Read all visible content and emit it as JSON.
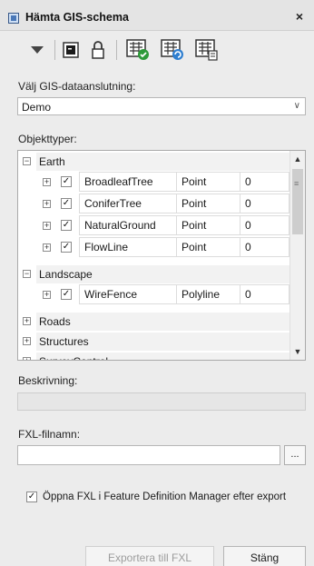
{
  "window": {
    "title": "Hämta GIS-schema",
    "close_glyph": "×"
  },
  "toolbar": {
    "buttons": [
      {
        "icon": "dropdown-arrow-icon"
      },
      {
        "icon": "terminal-window-icon"
      },
      {
        "icon": "lock-icon"
      },
      {
        "icon": "schema-check-icon"
      },
      {
        "icon": "schema-refresh-icon"
      },
      {
        "icon": "schema-export-icon"
      }
    ]
  },
  "connection": {
    "label": "Välj GIS-dataanslutning:",
    "selected": "Demo",
    "arrow_glyph": "∨"
  },
  "object_types": {
    "label": "Objekttyper:",
    "groups": [
      {
        "name": "Earth",
        "expanded": true,
        "items": [
          {
            "name": "BroadleafTree",
            "geometry": "Point",
            "count": "0",
            "checked": true
          },
          {
            "name": "ConiferTree",
            "geometry": "Point",
            "count": "0",
            "checked": true
          },
          {
            "name": "NaturalGround",
            "geometry": "Point",
            "count": "0",
            "checked": true
          },
          {
            "name": "FlowLine",
            "geometry": "Point",
            "count": "0",
            "checked": true
          }
        ]
      },
      {
        "name": "Landscape",
        "expanded": true,
        "items": [
          {
            "name": "WireFence",
            "geometry": "Polyline",
            "count": "0",
            "checked": true
          }
        ]
      },
      {
        "name": "Roads",
        "expanded": false,
        "items": []
      },
      {
        "name": "Structures",
        "expanded": false,
        "items": []
      },
      {
        "name": "SurveyControl",
        "expanded": false,
        "items": []
      }
    ]
  },
  "description": {
    "label": "Beskrivning:",
    "value": ""
  },
  "fxl_file": {
    "label": "FXL-filnamn:",
    "value": "",
    "browse_label": "..."
  },
  "open_option": {
    "label": "Öppna FXL i Feature Definition Manager efter export",
    "checked": true
  },
  "buttons": {
    "export": "Exportera till FXL",
    "close": "Stäng"
  },
  "colors": {
    "accent_green": "#2e9a3a",
    "accent_blue": "#2f7fd0"
  }
}
